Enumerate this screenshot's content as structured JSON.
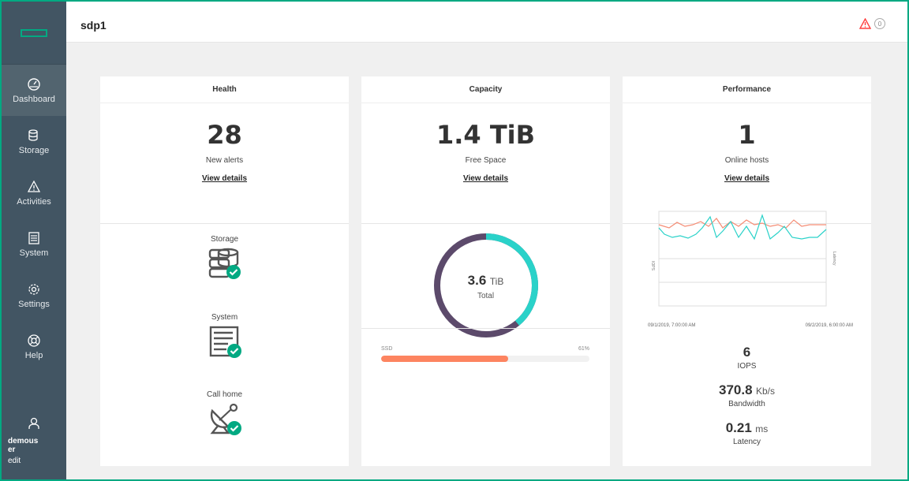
{
  "sidebar": {
    "items": [
      {
        "label": "Dashboard",
        "icon": "dashboard-icon"
      },
      {
        "label": "Storage",
        "icon": "storage-icon"
      },
      {
        "label": "Activities",
        "icon": "activities-icon"
      },
      {
        "label": "System",
        "icon": "system-icon"
      },
      {
        "label": "Settings",
        "icon": "settings-icon"
      },
      {
        "label": "Help",
        "icon": "help-icon"
      }
    ],
    "user": {
      "name": "demouser",
      "edit": "edit"
    }
  },
  "header": {
    "title": "sdp1",
    "alert_count": "0"
  },
  "health": {
    "title": "Health",
    "value": "28",
    "subtitle": "New alerts",
    "link": "View details",
    "statuses": [
      {
        "label": "Storage",
        "icon": "storage-status-icon",
        "state": "ok"
      },
      {
        "label": "System",
        "icon": "system-status-icon",
        "state": "ok"
      },
      {
        "label": "Call home",
        "icon": "satellite-dish-icon",
        "state": "ok"
      }
    ]
  },
  "capacity": {
    "title": "Capacity",
    "value": "1.4 TiB",
    "subtitle": "Free Space",
    "link": "View details",
    "total_value": "3.6",
    "total_unit": "TiB",
    "total_label": "Total",
    "used_fraction": 0.61,
    "ssd": {
      "label": "SSD",
      "percent_label": "61%",
      "percent": 61
    }
  },
  "performance": {
    "title": "Performance",
    "value": "1",
    "subtitle": "Online hosts",
    "link": "View details",
    "chart": {
      "y_left_label": "IOPS",
      "y_right_label": "Latency",
      "x_start": "09/1/2019, 7:00:00 AM",
      "x_end": "09/2/2019, 6:00:00 AM"
    },
    "iops": {
      "value": "6",
      "unit": "",
      "label": "IOPS"
    },
    "bandwidth": {
      "value": "370.8",
      "unit": "Kb/s",
      "label": "Bandwidth"
    },
    "latency": {
      "value": "0.21",
      "unit": "ms",
      "label": "Latency"
    }
  },
  "colors": {
    "accent": "#01a982",
    "sidebar": "#425563",
    "donut_used": "#5c4a6b",
    "donut_free": "#2ad2c9",
    "ssd_fill": "#fd8460",
    "alert": "#ff4040"
  }
}
